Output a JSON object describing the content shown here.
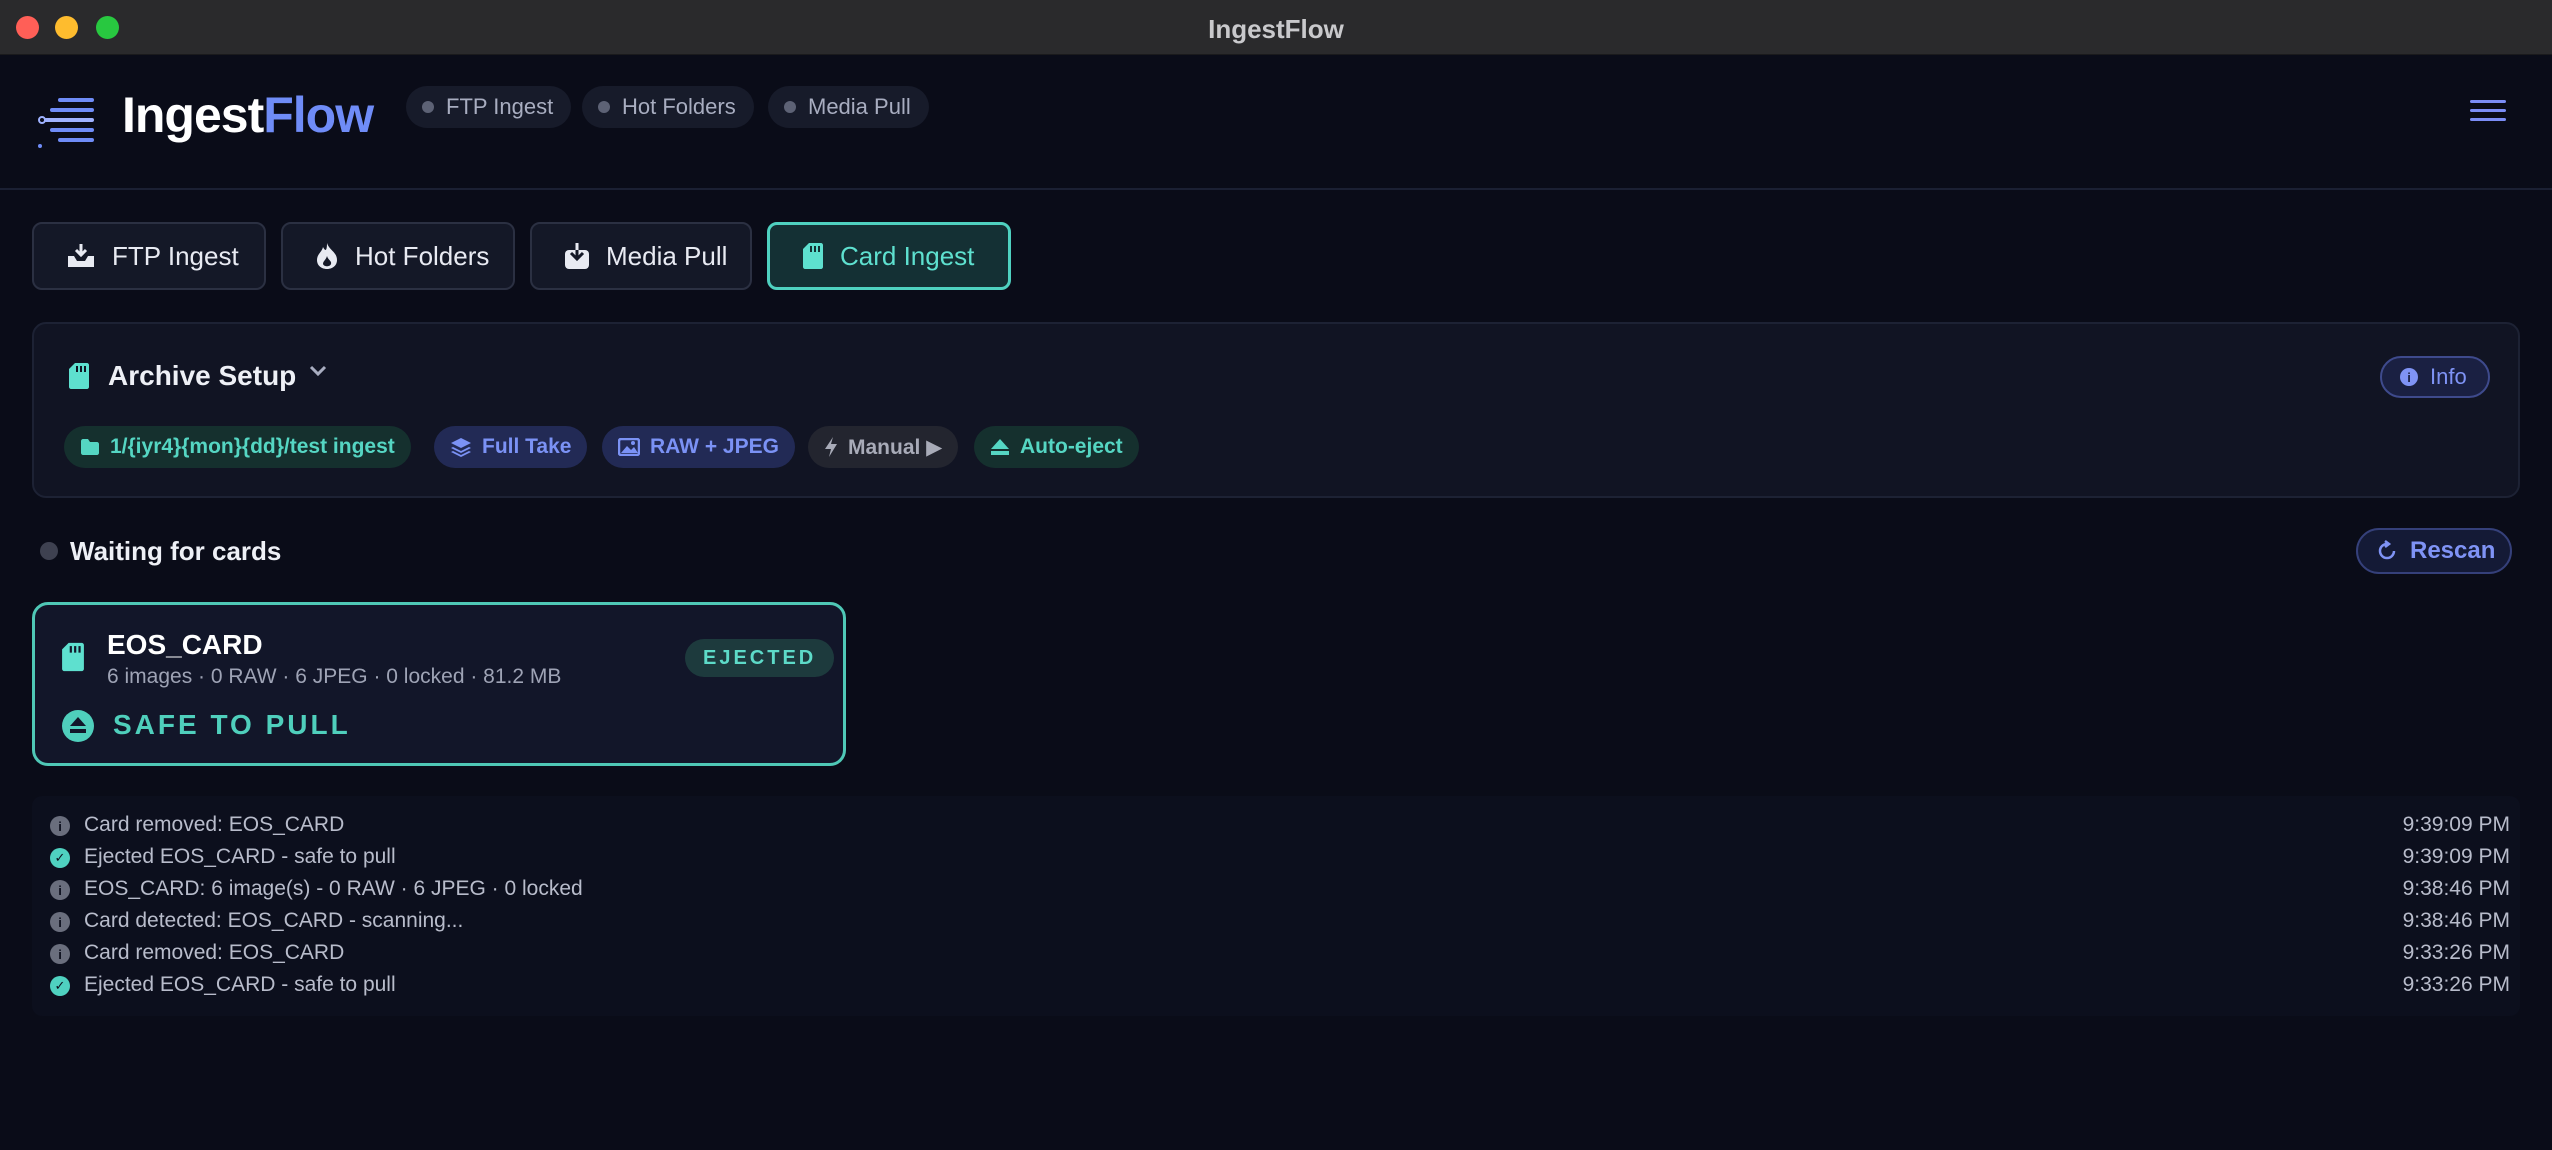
{
  "window": {
    "title": "IngestFlow"
  },
  "header": {
    "logo_part1": "Ingest",
    "logo_part2": "Flow",
    "nav_pills": [
      "FTP Ingest",
      "Hot Folders",
      "Media Pull"
    ]
  },
  "tabs": [
    {
      "label": "FTP Ingest",
      "icon": "inbox-tray-icon"
    },
    {
      "label": "Hot Folders",
      "icon": "flame-icon"
    },
    {
      "label": "Media Pull",
      "icon": "download-icon"
    },
    {
      "label": "Card Ingest",
      "icon": "sd-card-icon",
      "active": true
    }
  ],
  "archive_setup": {
    "title": "Archive Setup",
    "info_label": "Info",
    "chips": {
      "path": "1/{iyr4}{mon}{dd}/test ingest",
      "take": "Full Take",
      "format": "RAW + JPEG",
      "mode": "Manual ▶",
      "eject": "Auto-eject"
    }
  },
  "status": {
    "text": "Waiting for cards",
    "rescan_label": "Rescan"
  },
  "card": {
    "name": "EOS_CARD",
    "meta": "6 images · 0 RAW · 6 JPEG · 0 locked · 81.2 MB",
    "badge": "EJECTED",
    "safe_text": "SAFE TO PULL"
  },
  "log": [
    {
      "type": "info",
      "message": "Card removed: EOS_CARD",
      "time": "9:39:09 PM"
    },
    {
      "type": "success",
      "message": "Ejected EOS_CARD - safe to pull",
      "time": "9:39:09 PM"
    },
    {
      "type": "info",
      "message": "EOS_CARD: 6 image(s) - 0 RAW · 6 JPEG · 0 locked",
      "time": "9:38:46 PM"
    },
    {
      "type": "info",
      "message": "Card detected: EOS_CARD - scanning...",
      "time": "9:38:46 PM"
    },
    {
      "type": "info",
      "message": "Card removed: EOS_CARD",
      "time": "9:33:26 PM"
    },
    {
      "type": "success",
      "message": "Ejected EOS_CARD - safe to pull",
      "time": "9:33:26 PM"
    }
  ],
  "colors": {
    "accent_teal": "#4fd1c0",
    "accent_blue": "#7f93f5",
    "background": "#0a0c18"
  }
}
